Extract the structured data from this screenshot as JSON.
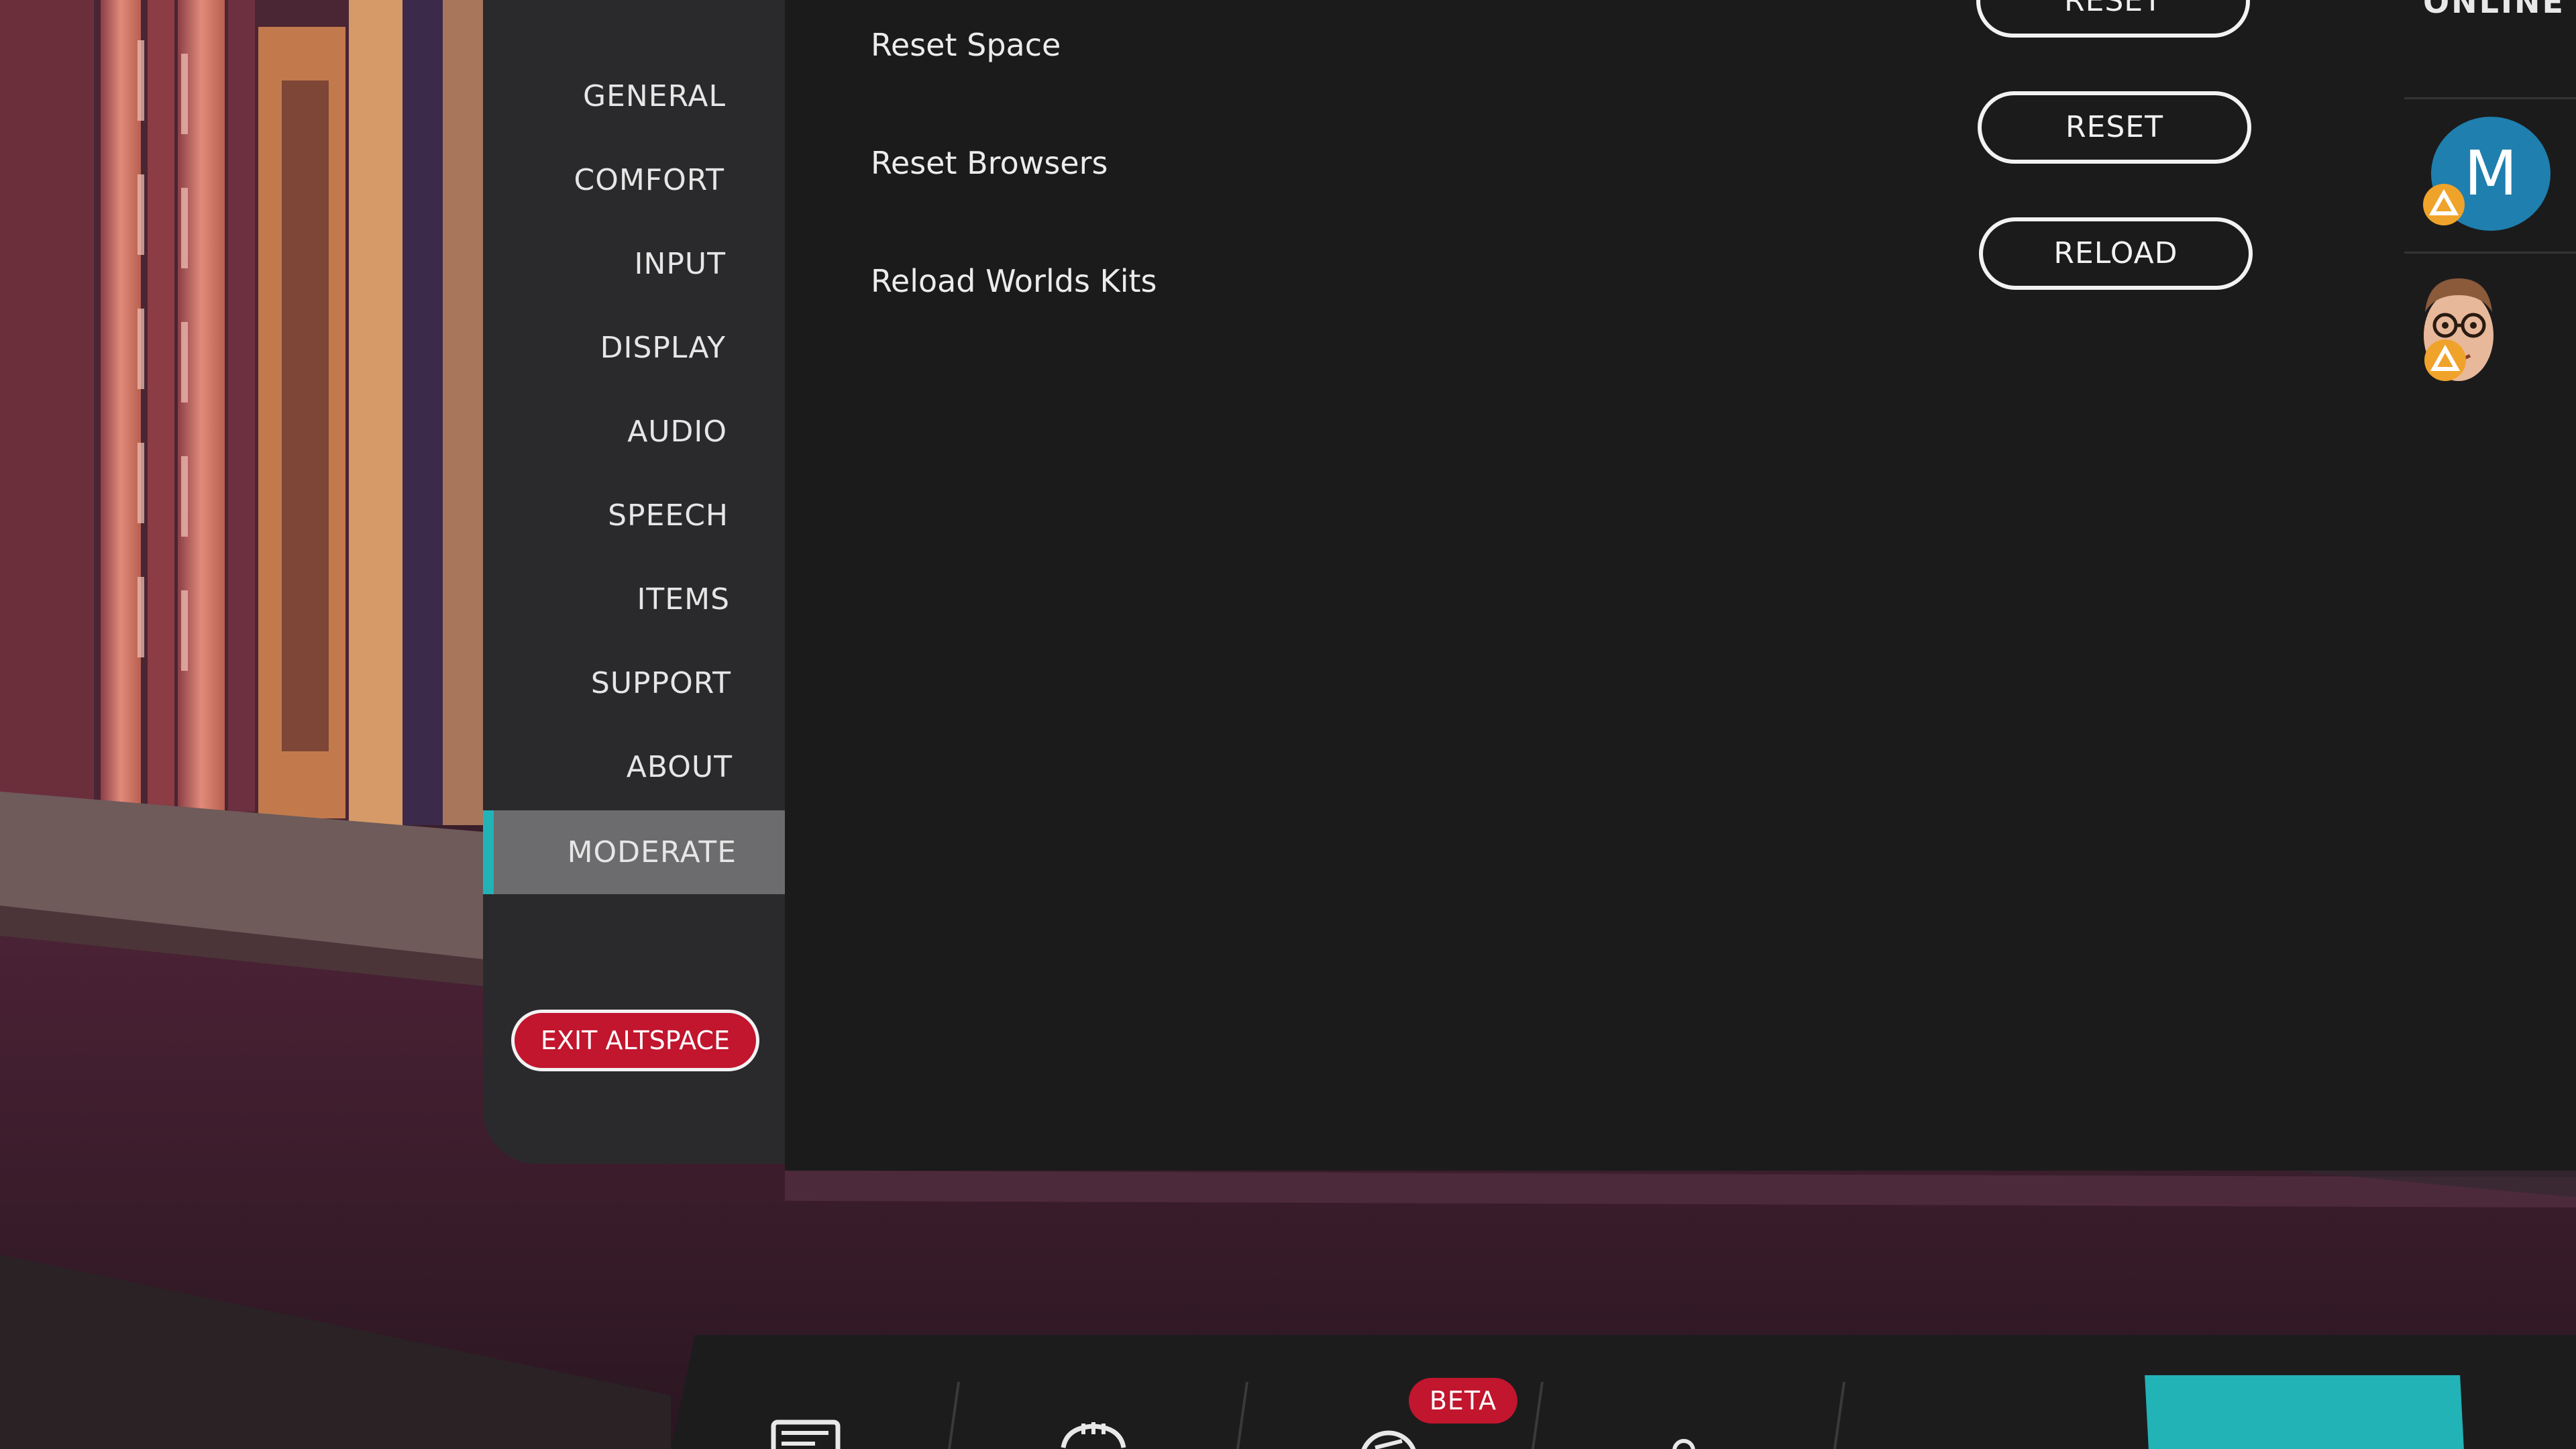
{
  "sidebar": {
    "items": [
      {
        "label": "GENERAL"
      },
      {
        "label": "COMFORT"
      },
      {
        "label": "INPUT"
      },
      {
        "label": "DISPLAY"
      },
      {
        "label": "AUDIO"
      },
      {
        "label": "SPEECH"
      },
      {
        "label": "ITEMS"
      },
      {
        "label": "SUPPORT"
      },
      {
        "label": "ABOUT"
      },
      {
        "label": "MODERATE"
      }
    ],
    "active": "MODERATE",
    "exit_label": "EXIT ALTSPACE"
  },
  "moderate": {
    "rows": [
      {
        "label": "Reset Space",
        "button": "RESET"
      },
      {
        "label": "Reset Browsers",
        "button": "RESET"
      },
      {
        "label": "Reload Worlds Kits",
        "button": "RELOAD"
      }
    ]
  },
  "online": {
    "title": "ONLINE",
    "users": [
      {
        "initial": "M",
        "avatar_color": "#1f7fae",
        "badge_icon": "host-icon"
      },
      {
        "avatar": "cartoon-face-avatar",
        "badge_icon": "host-icon"
      }
    ]
  },
  "dock": {
    "beta_label": "BETA",
    "icons": [
      "events-icon",
      "worlds-icon",
      "explore-icon",
      "people-icon"
    ]
  },
  "colors": {
    "accent": "#22b3b7",
    "exit": "#c2152e",
    "panel": "#1b1b1c",
    "sidebar": "#2a2a2c",
    "badge": "#f0a32a"
  }
}
